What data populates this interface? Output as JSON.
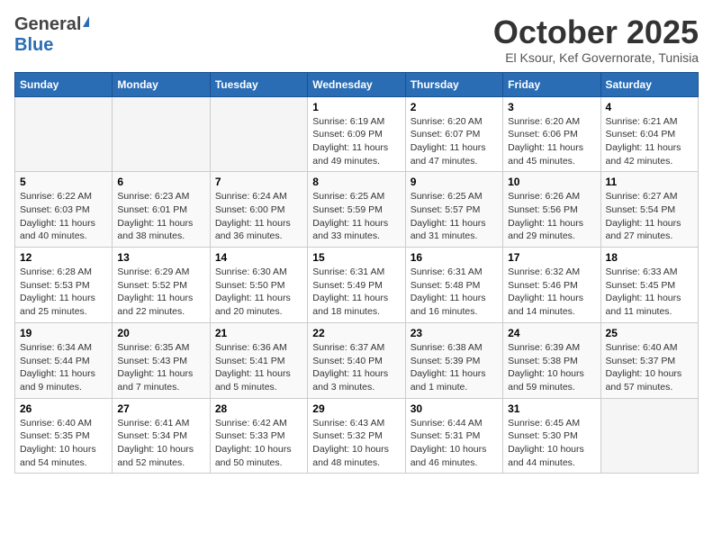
{
  "header": {
    "logo_general": "General",
    "logo_blue": "Blue",
    "month": "October 2025",
    "location": "El Ksour, Kef Governorate, Tunisia"
  },
  "days_of_week": [
    "Sunday",
    "Monday",
    "Tuesday",
    "Wednesday",
    "Thursday",
    "Friday",
    "Saturday"
  ],
  "weeks": [
    {
      "days": [
        {
          "number": "",
          "info": ""
        },
        {
          "number": "",
          "info": ""
        },
        {
          "number": "",
          "info": ""
        },
        {
          "number": "1",
          "info": "Sunrise: 6:19 AM\nSunset: 6:09 PM\nDaylight: 11 hours and 49 minutes."
        },
        {
          "number": "2",
          "info": "Sunrise: 6:20 AM\nSunset: 6:07 PM\nDaylight: 11 hours and 47 minutes."
        },
        {
          "number": "3",
          "info": "Sunrise: 6:20 AM\nSunset: 6:06 PM\nDaylight: 11 hours and 45 minutes."
        },
        {
          "number": "4",
          "info": "Sunrise: 6:21 AM\nSunset: 6:04 PM\nDaylight: 11 hours and 42 minutes."
        }
      ]
    },
    {
      "days": [
        {
          "number": "5",
          "info": "Sunrise: 6:22 AM\nSunset: 6:03 PM\nDaylight: 11 hours and 40 minutes."
        },
        {
          "number": "6",
          "info": "Sunrise: 6:23 AM\nSunset: 6:01 PM\nDaylight: 11 hours and 38 minutes."
        },
        {
          "number": "7",
          "info": "Sunrise: 6:24 AM\nSunset: 6:00 PM\nDaylight: 11 hours and 36 minutes."
        },
        {
          "number": "8",
          "info": "Sunrise: 6:25 AM\nSunset: 5:59 PM\nDaylight: 11 hours and 33 minutes."
        },
        {
          "number": "9",
          "info": "Sunrise: 6:25 AM\nSunset: 5:57 PM\nDaylight: 11 hours and 31 minutes."
        },
        {
          "number": "10",
          "info": "Sunrise: 6:26 AM\nSunset: 5:56 PM\nDaylight: 11 hours and 29 minutes."
        },
        {
          "number": "11",
          "info": "Sunrise: 6:27 AM\nSunset: 5:54 PM\nDaylight: 11 hours and 27 minutes."
        }
      ]
    },
    {
      "days": [
        {
          "number": "12",
          "info": "Sunrise: 6:28 AM\nSunset: 5:53 PM\nDaylight: 11 hours and 25 minutes."
        },
        {
          "number": "13",
          "info": "Sunrise: 6:29 AM\nSunset: 5:52 PM\nDaylight: 11 hours and 22 minutes."
        },
        {
          "number": "14",
          "info": "Sunrise: 6:30 AM\nSunset: 5:50 PM\nDaylight: 11 hours and 20 minutes."
        },
        {
          "number": "15",
          "info": "Sunrise: 6:31 AM\nSunset: 5:49 PM\nDaylight: 11 hours and 18 minutes."
        },
        {
          "number": "16",
          "info": "Sunrise: 6:31 AM\nSunset: 5:48 PM\nDaylight: 11 hours and 16 minutes."
        },
        {
          "number": "17",
          "info": "Sunrise: 6:32 AM\nSunset: 5:46 PM\nDaylight: 11 hours and 14 minutes."
        },
        {
          "number": "18",
          "info": "Sunrise: 6:33 AM\nSunset: 5:45 PM\nDaylight: 11 hours and 11 minutes."
        }
      ]
    },
    {
      "days": [
        {
          "number": "19",
          "info": "Sunrise: 6:34 AM\nSunset: 5:44 PM\nDaylight: 11 hours and 9 minutes."
        },
        {
          "number": "20",
          "info": "Sunrise: 6:35 AM\nSunset: 5:43 PM\nDaylight: 11 hours and 7 minutes."
        },
        {
          "number": "21",
          "info": "Sunrise: 6:36 AM\nSunset: 5:41 PM\nDaylight: 11 hours and 5 minutes."
        },
        {
          "number": "22",
          "info": "Sunrise: 6:37 AM\nSunset: 5:40 PM\nDaylight: 11 hours and 3 minutes."
        },
        {
          "number": "23",
          "info": "Sunrise: 6:38 AM\nSunset: 5:39 PM\nDaylight: 11 hours and 1 minute."
        },
        {
          "number": "24",
          "info": "Sunrise: 6:39 AM\nSunset: 5:38 PM\nDaylight: 10 hours and 59 minutes."
        },
        {
          "number": "25",
          "info": "Sunrise: 6:40 AM\nSunset: 5:37 PM\nDaylight: 10 hours and 57 minutes."
        }
      ]
    },
    {
      "days": [
        {
          "number": "26",
          "info": "Sunrise: 6:40 AM\nSunset: 5:35 PM\nDaylight: 10 hours and 54 minutes."
        },
        {
          "number": "27",
          "info": "Sunrise: 6:41 AM\nSunset: 5:34 PM\nDaylight: 10 hours and 52 minutes."
        },
        {
          "number": "28",
          "info": "Sunrise: 6:42 AM\nSunset: 5:33 PM\nDaylight: 10 hours and 50 minutes."
        },
        {
          "number": "29",
          "info": "Sunrise: 6:43 AM\nSunset: 5:32 PM\nDaylight: 10 hours and 48 minutes."
        },
        {
          "number": "30",
          "info": "Sunrise: 6:44 AM\nSunset: 5:31 PM\nDaylight: 10 hours and 46 minutes."
        },
        {
          "number": "31",
          "info": "Sunrise: 6:45 AM\nSunset: 5:30 PM\nDaylight: 10 hours and 44 minutes."
        },
        {
          "number": "",
          "info": ""
        }
      ]
    }
  ]
}
